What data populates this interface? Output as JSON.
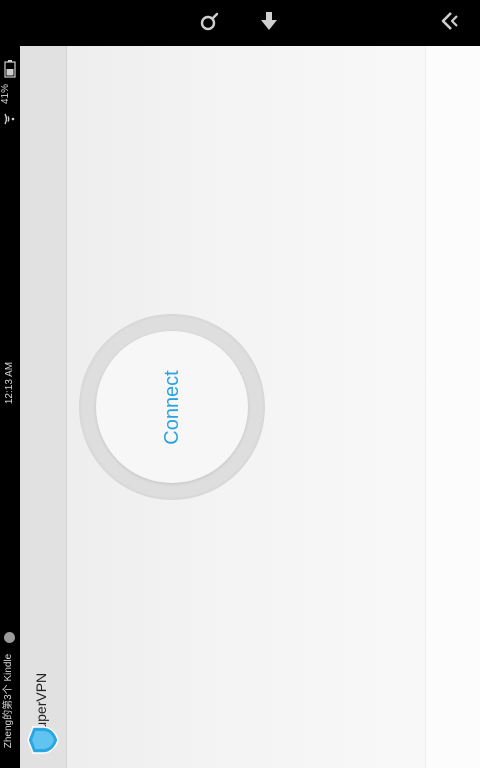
{
  "nav_bar": {
    "buttons": [
      {
        "icon": "search-icon"
      },
      {
        "icon": "download-icon"
      },
      {
        "icon": "back-icon"
      }
    ]
  },
  "status_bar": {
    "device_name": "Zheng的第3个 Kindle",
    "time": "12:13 AM",
    "battery": "41%",
    "icons": [
      "wifi-icon",
      "battery-icon",
      "notification-icon"
    ]
  },
  "app": {
    "title": "SuperVPN",
    "logo_text": "Super VPN",
    "connect_label": "Connect",
    "accent_color": "#27a4e0"
  }
}
